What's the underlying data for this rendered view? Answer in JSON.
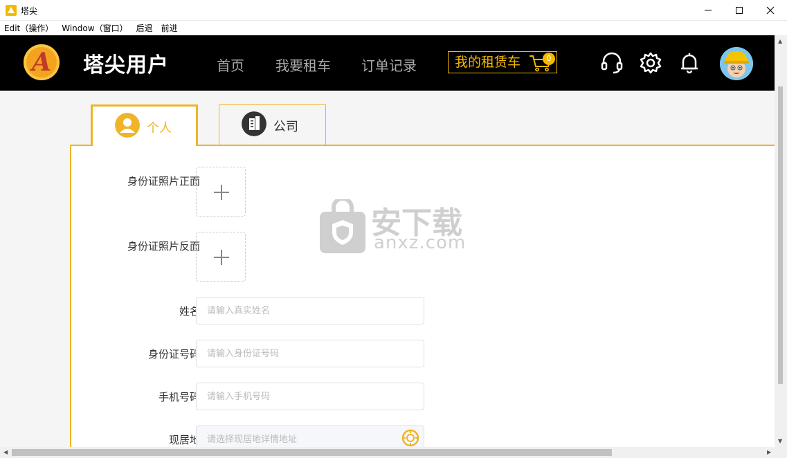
{
  "window": {
    "title": "塔尖"
  },
  "menu": {
    "items": [
      "Edit（操作）",
      "Window（窗口）",
      "后退",
      "前进"
    ]
  },
  "header": {
    "brand": "塔尖用户",
    "logo_letter": "A",
    "nav": [
      "首页",
      "我要租车",
      "订单记录"
    ],
    "cart_label": "我的租赁车",
    "cart_count": "0",
    "icons": [
      "headset-icon",
      "gear-icon",
      "bell-icon",
      "avatar"
    ],
    "accent_color": "#f5b800"
  },
  "tabs": [
    {
      "label": "个人",
      "active": true,
      "icon": "person-icon"
    },
    {
      "label": "公司",
      "active": false,
      "icon": "building-icon"
    }
  ],
  "form": {
    "id_front_label": "身份证照片正面",
    "id_back_label": "身份证照片反面",
    "name_label": "姓名",
    "name_placeholder": "请输入真实姓名",
    "id_number_label": "身份证号码",
    "id_number_placeholder": "请输入身份证号码",
    "phone_label": "手机号码",
    "phone_placeholder": "请输入手机号码",
    "address_label": "现居地",
    "address_placeholder": "请选择现居地详情地址"
  },
  "watermark": {
    "text": "安下载",
    "url": "anxz.com"
  }
}
